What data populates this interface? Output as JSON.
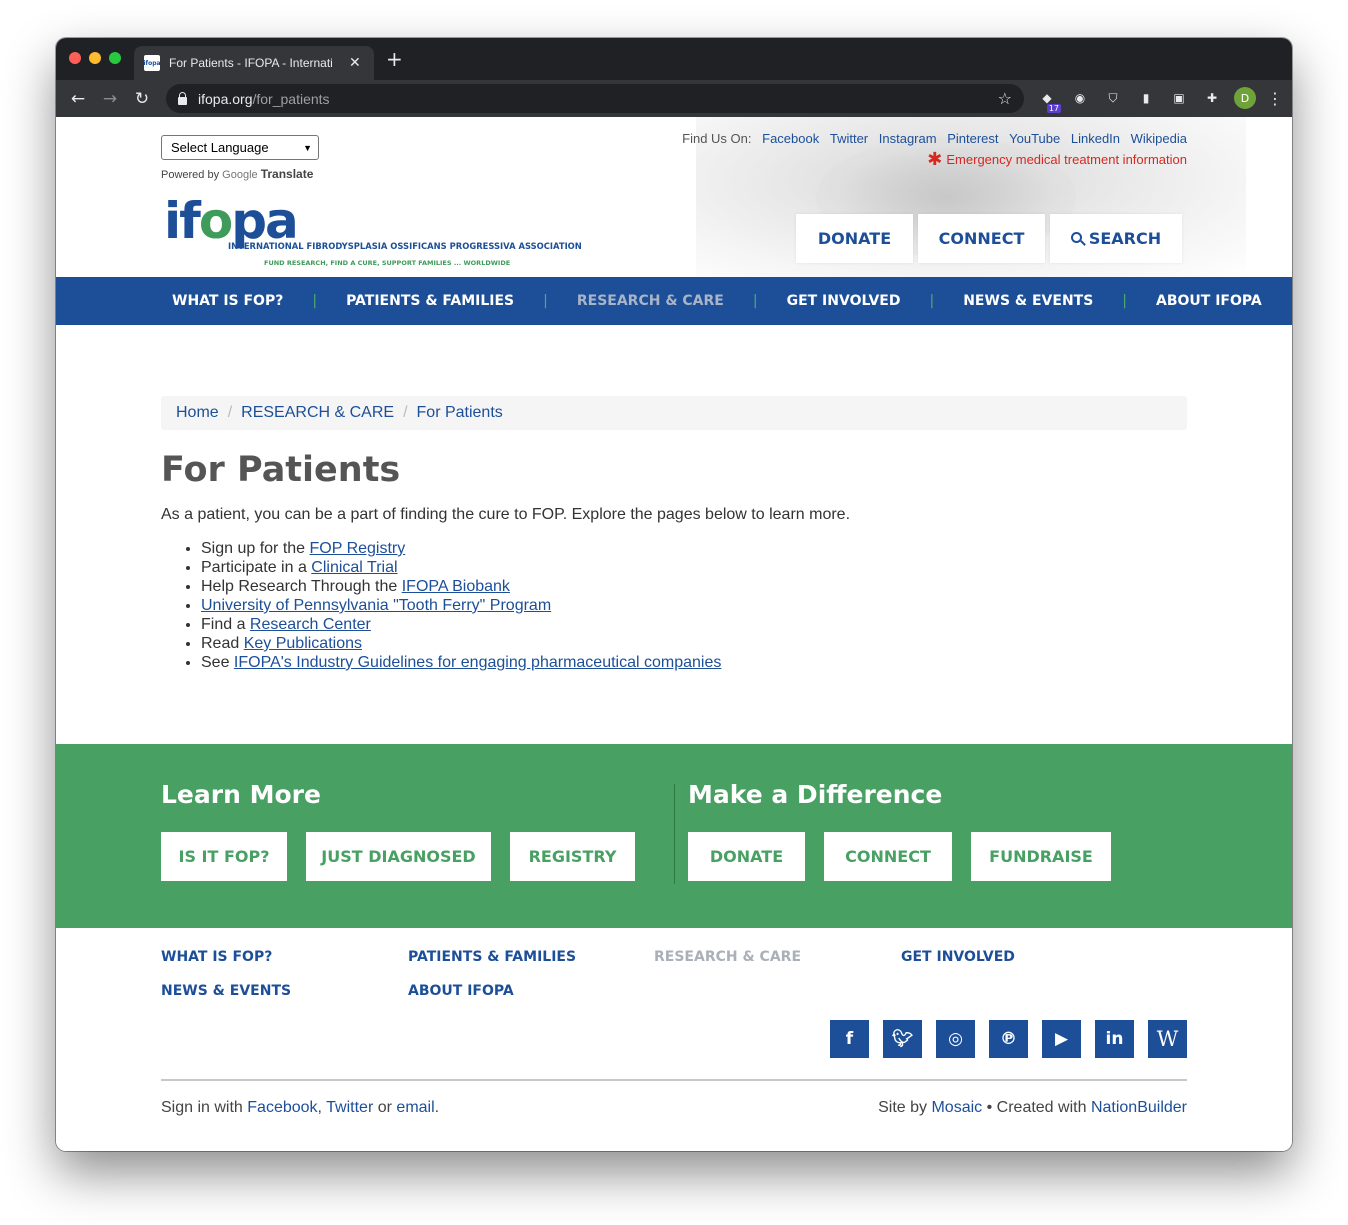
{
  "browser": {
    "tab_title": "For Patients - IFOPA - Internati",
    "tab_favicon": "ifopa",
    "url_host": "ifopa.org",
    "url_path": "/for_patients",
    "ext_badge": "17",
    "avatar_initial": "D"
  },
  "header": {
    "language_select": "Select Language",
    "powered_by": "Powered by",
    "google": "Google",
    "translate": "Translate",
    "find_us_label": "Find Us On:",
    "social_links": [
      "Facebook",
      "Twitter",
      "Instagram",
      "Pinterest",
      "YouTube",
      "LinkedIn",
      "Wikipedia"
    ],
    "emergency": "Emergency medical treatment information",
    "logo": {
      "word_start": "if",
      "word_o": "o",
      "word_end": "pa",
      "full_name": "INTERNATIONAL FIBRODYSPLASIA OSSIFICANS PROGRESSIVA ASSOCIATION",
      "tagline": "FUND RESEARCH, FIND A CURE, SUPPORT FAMILIES ... WORLDWIDE"
    },
    "buttons": {
      "donate": "DONATE",
      "connect": "CONNECT",
      "search": "SEARCH"
    }
  },
  "nav": [
    "WHAT IS FOP?",
    "PATIENTS & FAMILIES",
    "RESEARCH & CARE",
    "GET INVOLVED",
    "NEWS & EVENTS",
    "ABOUT IFOPA"
  ],
  "breadcrumb": [
    "Home",
    "RESEARCH & CARE",
    "For Patients"
  ],
  "main": {
    "title": "For Patients",
    "intro": "As a patient, you can be a part of finding the cure to FOP. Explore the pages below to learn more.",
    "items": [
      {
        "prefix": "Sign up for the ",
        "link": "FOP Registry"
      },
      {
        "prefix": "Participate in a ",
        "link": "Clinical Trial"
      },
      {
        "prefix": "Help Research Through the ",
        "link": "IFOPA Biobank"
      },
      {
        "prefix": "",
        "link": "University of Pennsylvania \"Tooth Ferry\" Program"
      },
      {
        "prefix": "Find a ",
        "link": "Research Center"
      },
      {
        "prefix": "Read ",
        "link": "Key Publications"
      },
      {
        "prefix": "See ",
        "link": "IFOPA's Industry Guidelines for engaging pharmaceutical companies"
      }
    ]
  },
  "band": {
    "learn_title": "Learn More",
    "learn_buttons": [
      "IS IT FOP?",
      "JUST DIAGNOSED",
      "REGISTRY"
    ],
    "diff_title": "Make a Difference",
    "diff_buttons": [
      "DONATE",
      "CONNECT",
      "FUNDRAISE"
    ]
  },
  "footer": {
    "links": [
      "WHAT IS FOP?",
      "PATIENTS & FAMILIES",
      "RESEARCH & CARE",
      "GET INVOLVED",
      "NEWS & EVENTS",
      "ABOUT IFOPA"
    ],
    "social_icons": [
      "facebook-icon",
      "twitter-icon",
      "instagram-icon",
      "pinterest-icon",
      "youtube-icon",
      "linkedin-icon",
      "wikipedia-icon"
    ],
    "sign_in": "Sign in with",
    "sign_facebook": "Facebook",
    "comma": ",",
    "sign_twitter": "Twitter",
    "sign_or": "or",
    "sign_email": "email",
    "period": ".",
    "site_by": "Site by",
    "mosaic": "Mosaic",
    "created_with": "• Created with",
    "nationbuilder": "NationBuilder"
  },
  "colors": {
    "brand_blue": "#1d4f99",
    "brand_green": "#48a063",
    "emergency_red": "#d6281f"
  }
}
